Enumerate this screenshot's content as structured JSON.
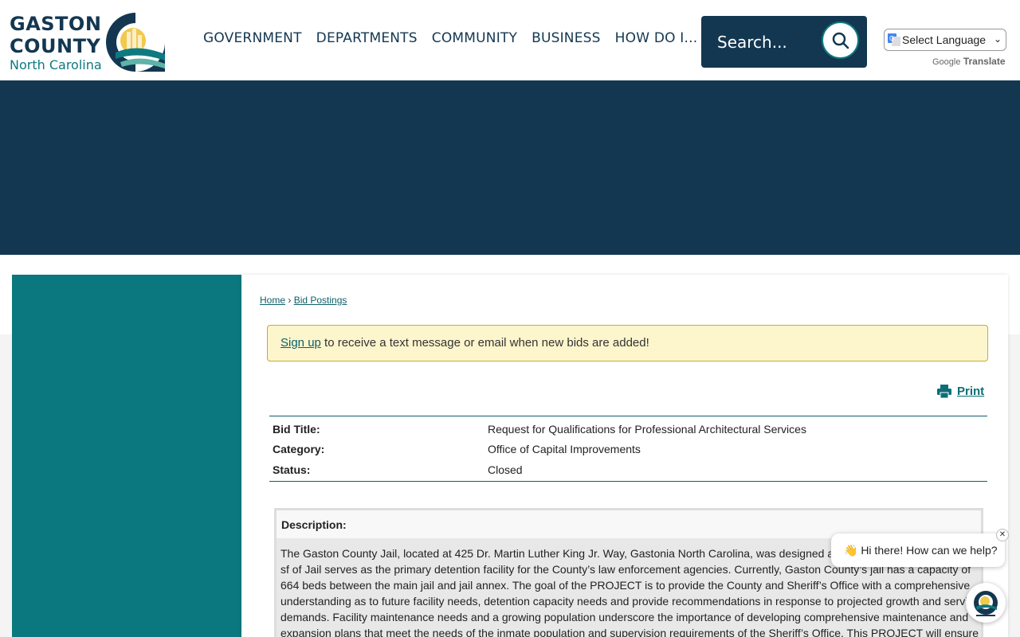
{
  "header": {
    "logo": {
      "line1": "GASTON",
      "line2": "COUNTY",
      "line3": "North Carolina"
    },
    "nav": [
      "GOVERNMENT",
      "DEPARTMENTS",
      "COMMUNITY",
      "BUSINESS",
      "HOW DO I..."
    ],
    "search": {
      "placeholder": "Search...",
      "icon": "search-icon"
    },
    "translate": {
      "select_label": "Select Language",
      "powered_google": "Google",
      "powered_translate": "Translate"
    }
  },
  "breadcrumb": {
    "home": "Home",
    "separator": "›",
    "current": "Bid Postings"
  },
  "alert": {
    "link": "Sign up",
    "text": " to receive a text message or email when new bids are added!"
  },
  "print": {
    "label": "Print",
    "icon": "printer-icon"
  },
  "bid": {
    "title_label": "Bid Title:",
    "title_value": "Request for Qualifications for Professional Architectural Services",
    "category_label": "Category:",
    "category_value": "Office of Capital Improvements",
    "status_label": "Status:",
    "status_value": "Closed"
  },
  "description": {
    "heading": "Description:",
    "body": "The Gaston County Jail, located at 425 Dr. Martin Luther King Jr. Way, Gastonia North Carolina, was designed and built in 1982. The 182,514 sf of Jail serves as the primary detention facility for the County’s law enforcement agencies. Currently, Gaston County’s jail has a capacity of 664 beds between the main jail and jail annex. The goal of the PROJECT is to provide the County and Sheriff’s Office with a comprehensive understanding as to future facility needs, detention capacity needs and provide recommendations in response to projected growth and service demands. Facility maintenance needs and a growing population underscore the importance of developing comprehensive maintenance and expansion plans that meet the needs of the inmate population and supervision requirements of the Sheriff’s Office. This PROJECT will ensure space"
  },
  "chat": {
    "greeting": "👋 Hi there! How can we help?",
    "close": "✕"
  },
  "colors": {
    "navy": "#133751",
    "teal": "#0a787e",
    "alert_bg": "#fdf5cc"
  }
}
